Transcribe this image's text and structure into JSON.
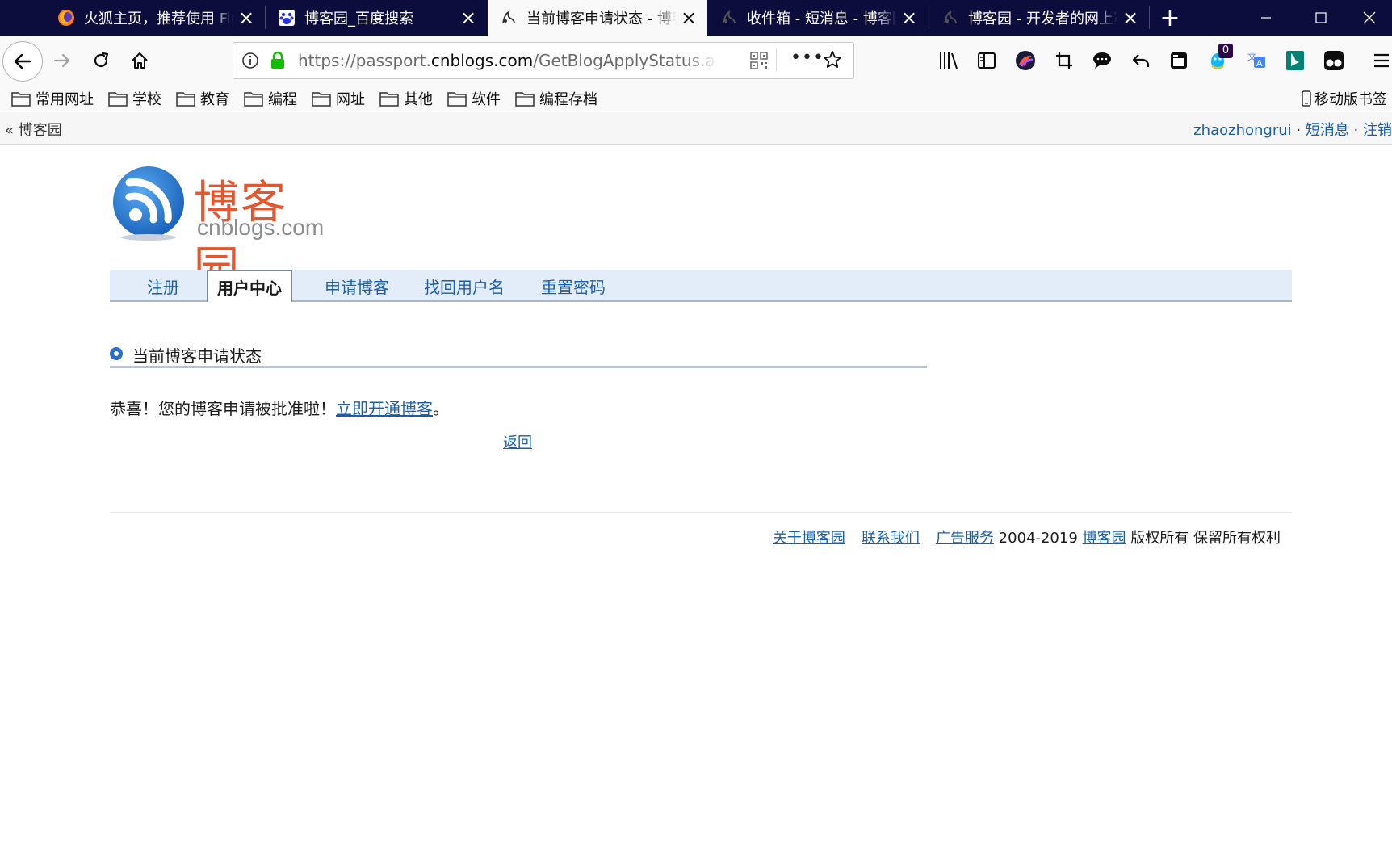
{
  "browser": {
    "tabs": [
      {
        "title": "火狐主页，推荐使用 Firefox",
        "icon": "firefox-icon",
        "active": false
      },
      {
        "title": "博客园_百度搜索",
        "icon": "baidu-icon",
        "active": false
      },
      {
        "title": "当前博客申请状态 - 博客园",
        "icon": "cnblogs-icon",
        "active": true
      },
      {
        "title": "收件箱 - 短消息 - 博客园",
        "icon": "cnblogs-icon",
        "active": false
      },
      {
        "title": "博客园 - 开发者的网上家园",
        "icon": "cnblogs-icon",
        "active": false
      }
    ],
    "new_tab_label": "+",
    "url_prefix": "https://passport.",
    "url_domain": "cnblogs.com",
    "url_path": "/GetBlogApplyStatus.aspx",
    "more_label": "•••",
    "toolbar_badge": "0",
    "bookmarks": [
      "常用网址",
      "学校",
      "教育",
      "编程",
      "网址",
      "其他",
      "软件",
      "编程存档"
    ],
    "mobile_bookmarks": "移动版书签"
  },
  "page": {
    "back_label": "« 博客园",
    "user": "zhaozhongrui",
    "sep": " · ",
    "messages_link": "短消息",
    "logout_link": "注销",
    "logo_cn": "博客园",
    "logo_en": "cnblogs.com",
    "nav": [
      {
        "label": "注册",
        "active": false
      },
      {
        "label": "用户中心",
        "active": true
      },
      {
        "label": "申请博客",
        "active": false
      },
      {
        "label": "找回用户名",
        "active": false
      },
      {
        "label": "重置密码",
        "active": false
      }
    ],
    "section_title": "当前博客申请状态",
    "message_text": "恭喜！您的博客申请被批准啦！",
    "message_link": "立即开通博客",
    "message_end": "。",
    "return_link": "返回",
    "footer": {
      "about": "关于博客园",
      "contact": "联系我们",
      "ads": "广告服务",
      "years": "2004-2019",
      "brand": "博客园",
      "rights": "版权所有 保留所有权利"
    }
  },
  "colors": {
    "tabstrip_bg": "#0c0c3d",
    "link": "#1a5ea8",
    "logo_red": "#e4572e",
    "nav_bg": "#e3ecf9"
  }
}
